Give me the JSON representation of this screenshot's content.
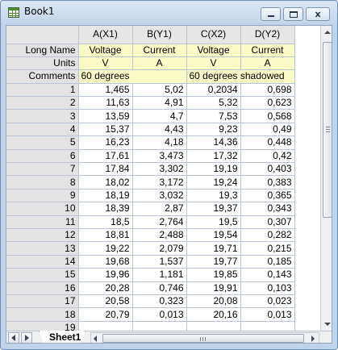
{
  "window": {
    "title": "Book1",
    "icon": "worksheet-icon",
    "buttons": {
      "minimize": "minimize-icon",
      "maximize": "maximize-icon",
      "close": "close-icon",
      "close_glyph": "x"
    }
  },
  "columns": [
    {
      "header": "A(X1)",
      "long_name": "Voltage",
      "units": "V"
    },
    {
      "header": "B(Y1)",
      "long_name": "Current",
      "units": "A"
    },
    {
      "header": "C(X2)",
      "long_name": "Voltage",
      "units": "V"
    },
    {
      "header": "D(Y2)",
      "long_name": "Current",
      "units": "A"
    }
  ],
  "labels": {
    "long_name": "Long Name",
    "units": "Units",
    "comments": "Comments"
  },
  "comments": {
    "ab": "60 degrees",
    "cd": "60 degrees shadowed"
  },
  "rows": [
    {
      "n": "1",
      "a": "1,465",
      "b": "5,02",
      "c": "0,2034",
      "d": "0,698"
    },
    {
      "n": "2",
      "a": "11,63",
      "b": "4,91",
      "c": "5,32",
      "d": "0,623"
    },
    {
      "n": "3",
      "a": "13,59",
      "b": "4,7",
      "c": "7,53",
      "d": "0,568"
    },
    {
      "n": "4",
      "a": "15,37",
      "b": "4,43",
      "c": "9,23",
      "d": "0,49"
    },
    {
      "n": "5",
      "a": "16,23",
      "b": "4,18",
      "c": "14,36",
      "d": "0,448"
    },
    {
      "n": "6",
      "a": "17,61",
      "b": "3,473",
      "c": "17,32",
      "d": "0,42"
    },
    {
      "n": "7",
      "a": "17,84",
      "b": "3,302",
      "c": "19,19",
      "d": "0,403"
    },
    {
      "n": "8",
      "a": "18,02",
      "b": "3,172",
      "c": "19,24",
      "d": "0,383"
    },
    {
      "n": "9",
      "a": "18,19",
      "b": "3,032",
      "c": "19,3",
      "d": "0,365"
    },
    {
      "n": "10",
      "a": "18,39",
      "b": "2,87",
      "c": "19,37",
      "d": "0,343"
    },
    {
      "n": "11",
      "a": "18,5",
      "b": "2,764",
      "c": "19,5",
      "d": "0,307"
    },
    {
      "n": "12",
      "a": "18,81",
      "b": "2,488",
      "c": "19,54",
      "d": "0,282"
    },
    {
      "n": "13",
      "a": "19,22",
      "b": "2,079",
      "c": "19,71",
      "d": "0,215"
    },
    {
      "n": "14",
      "a": "19,68",
      "b": "1,537",
      "c": "19,77",
      "d": "0,185"
    },
    {
      "n": "15",
      "a": "19,96",
      "b": "1,181",
      "c": "19,85",
      "d": "0,143"
    },
    {
      "n": "16",
      "a": "20,28",
      "b": "0,746",
      "c": "19,91",
      "d": "0,103"
    },
    {
      "n": "17",
      "a": "20,58",
      "b": "0,323",
      "c": "20,08",
      "d": "0,023"
    },
    {
      "n": "18",
      "a": "20,79",
      "b": "0,013",
      "c": "20,16",
      "d": "0,013"
    },
    {
      "n": "19",
      "a": "",
      "b": "",
      "c": "",
      "d": ""
    }
  ],
  "sheet_tab": "Sheet1",
  "nav": {
    "prev": "triangle-left-icon",
    "next": "triangle-right-icon"
  },
  "colors": {
    "metadata_fill": "#fbfbc8",
    "header_fill": "#e6e6e6",
    "frame": "#bfd3ea"
  }
}
